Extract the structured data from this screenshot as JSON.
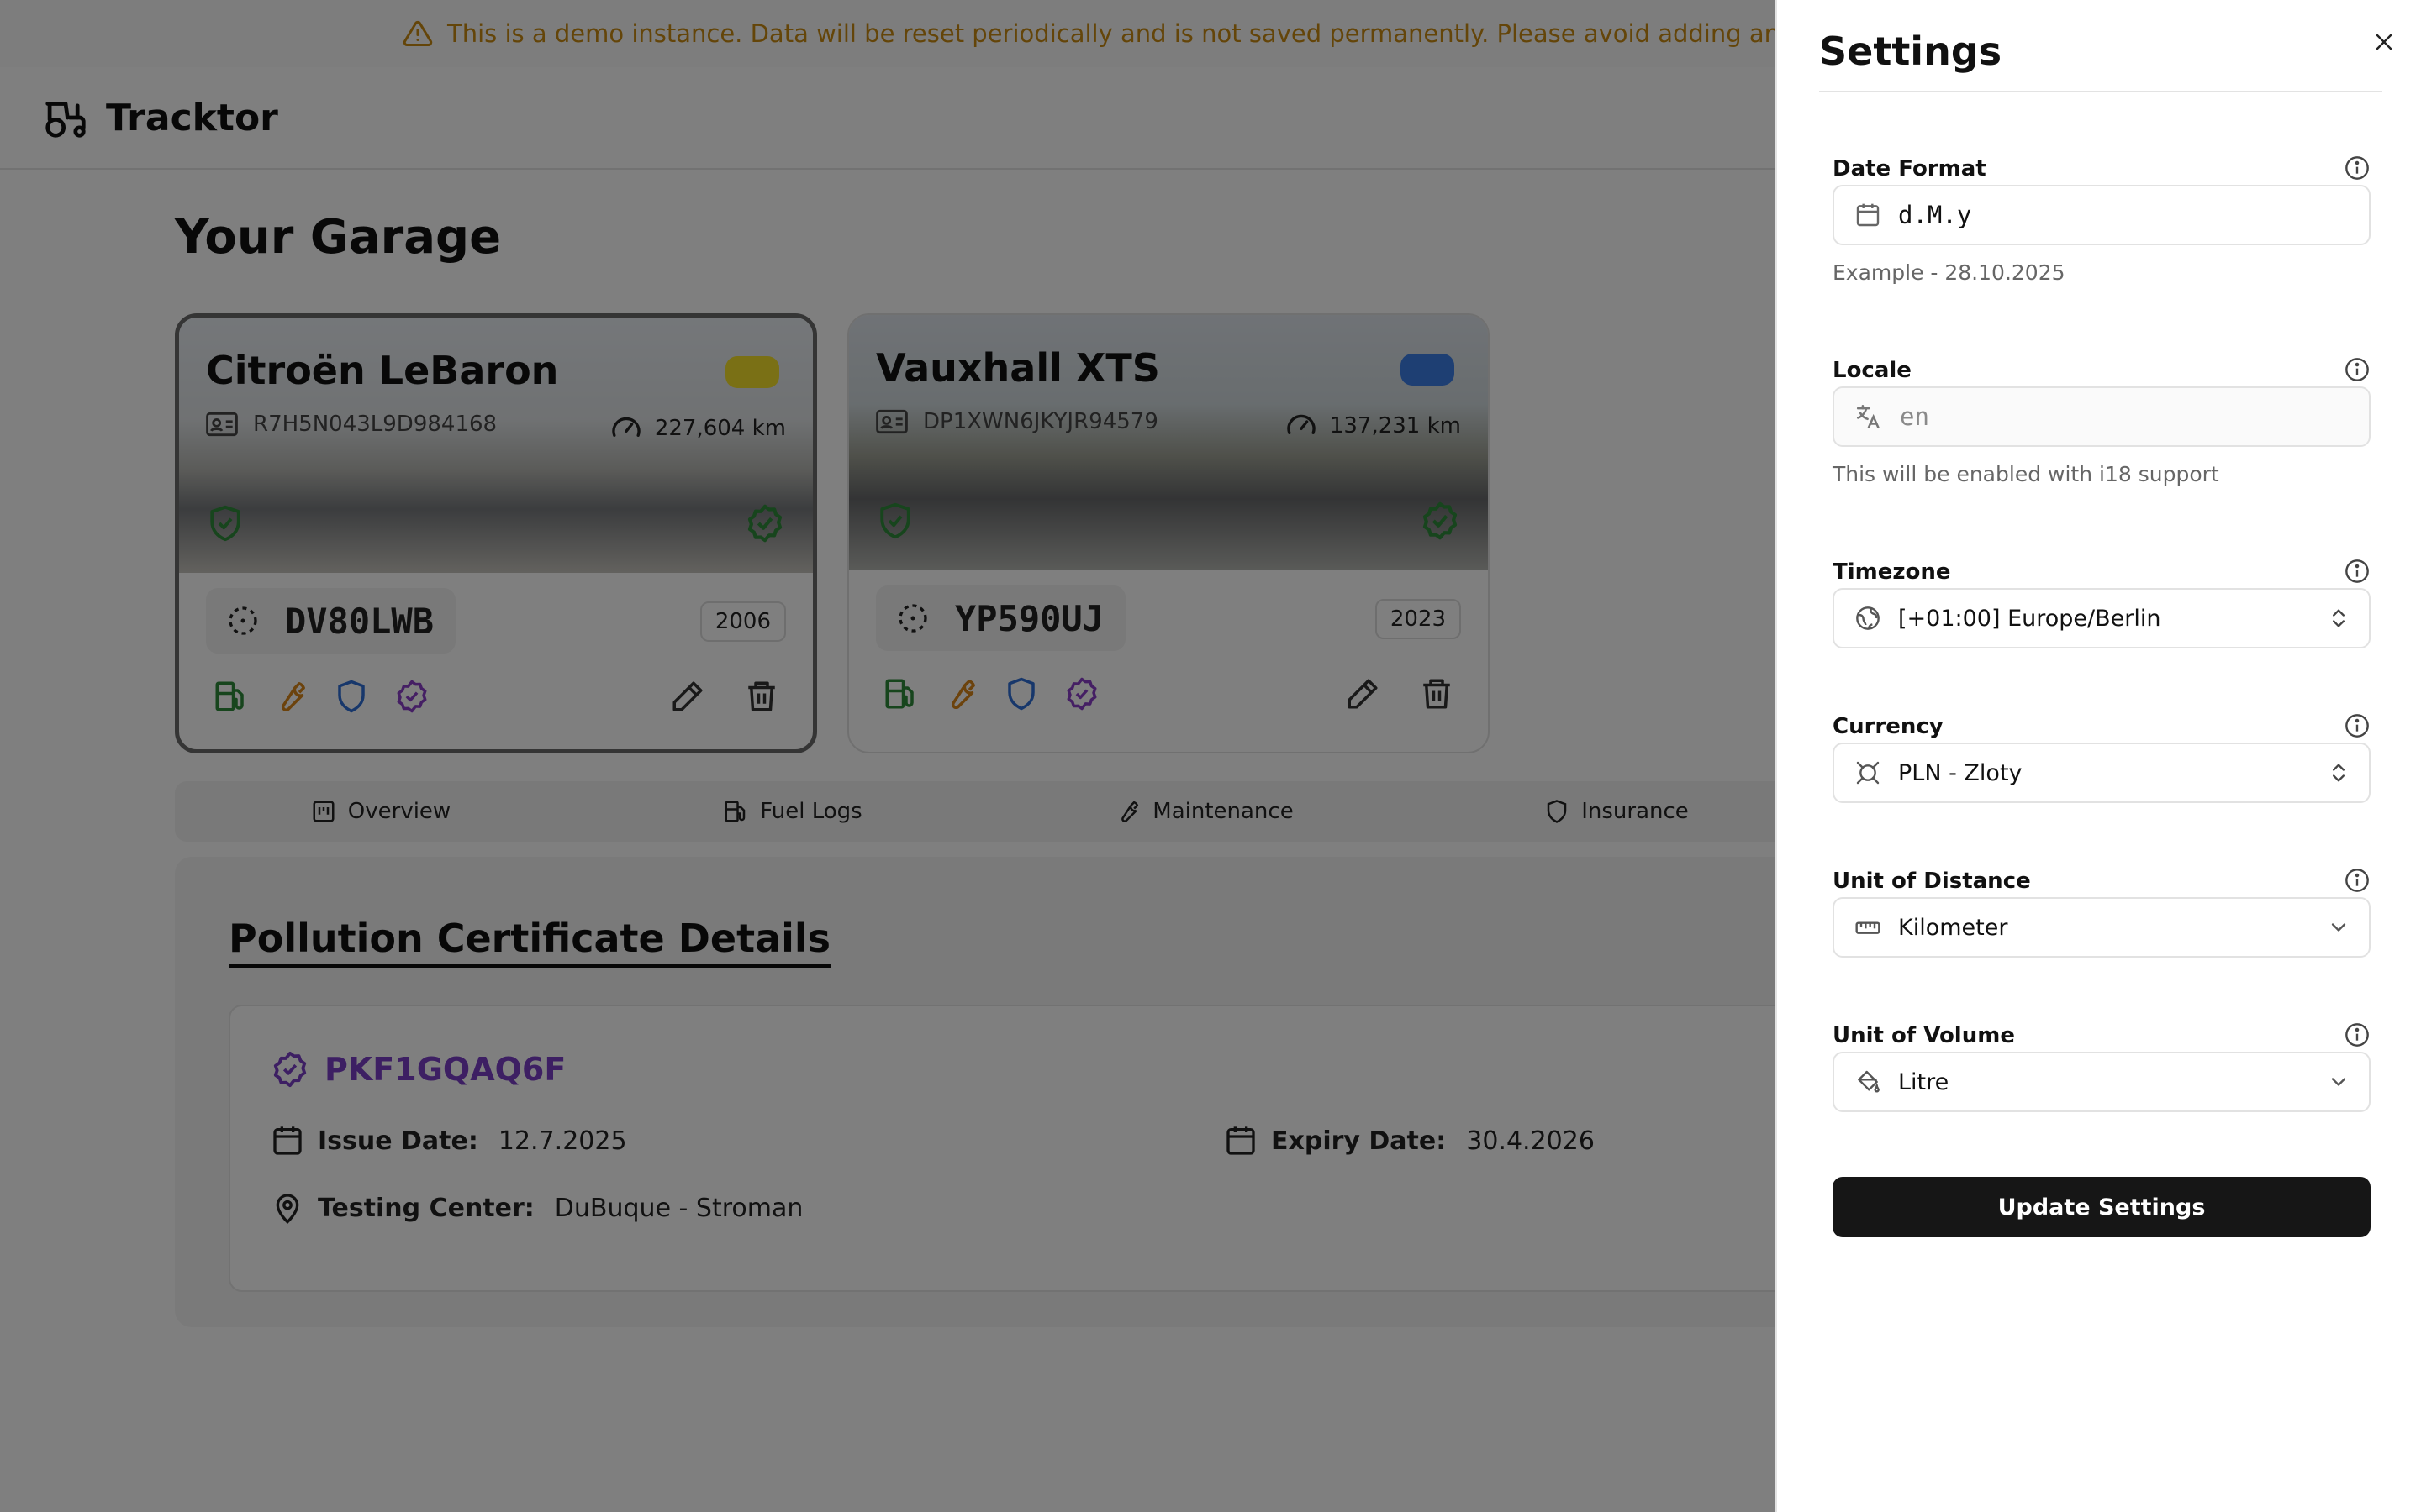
{
  "banner": {
    "text": "This is a demo instance. Data will be reset periodically and is not saved permanently. Please avoid adding any persoanl info",
    "color": "#c98a12"
  },
  "app": {
    "name": "Tracktor"
  },
  "garage": {
    "title": "Your Garage",
    "vehicles": [
      {
        "name": "Citroën LeBaron",
        "vin": "R7H5N043L9D984168",
        "odometer": "227,604 km",
        "plate": "DV80LWB",
        "year": "2006",
        "color": "#f5e12a",
        "selected": true
      },
      {
        "name": "Vauxhall XTS",
        "vin": "DP1XWN6JKYJR94579",
        "odometer": "137,231 km",
        "plate": "YP590UJ",
        "year": "2023",
        "color": "#3d7fe6",
        "selected": false
      }
    ]
  },
  "tabs": [
    {
      "label": "Overview",
      "icon": "overview-icon"
    },
    {
      "label": "Fuel Logs",
      "icon": "fuel-icon"
    },
    {
      "label": "Maintenance",
      "icon": "wrench-icon"
    },
    {
      "label": "Insurance",
      "icon": "shield-icon"
    }
  ],
  "certificate": {
    "section_title": "Pollution Certificate Details",
    "id": "PKF1GQAQ6F",
    "issue_label": "Issue Date:",
    "issue_date": "12.7.2025",
    "expiry_label": "Expiry Date:",
    "expiry_date": "30.4.2026",
    "center_label": "Testing Center:",
    "center": "DuBuque - Stroman"
  },
  "settings": {
    "title": "Settings",
    "date_format": {
      "label": "Date Format",
      "value": "d.M.y",
      "help": "Example - 28.10.2025"
    },
    "locale": {
      "label": "Locale",
      "value": "en",
      "help": "This will be enabled with i18 support"
    },
    "timezone": {
      "label": "Timezone",
      "value": "[+01:00] Europe/Berlin"
    },
    "currency": {
      "label": "Currency",
      "value": "PLN - Zloty"
    },
    "distance": {
      "label": "Unit of Distance",
      "value": "Kilometer"
    },
    "volume": {
      "label": "Unit of Volume",
      "value": "Litre"
    },
    "submit_label": "Update Settings"
  },
  "colors": {
    "accent_green": "#2f8a3a",
    "accent_orange": "#d9861a",
    "accent_blue": "#2f6fd6",
    "accent_purple": "#8b3ec8",
    "button_dark": "#161616"
  }
}
